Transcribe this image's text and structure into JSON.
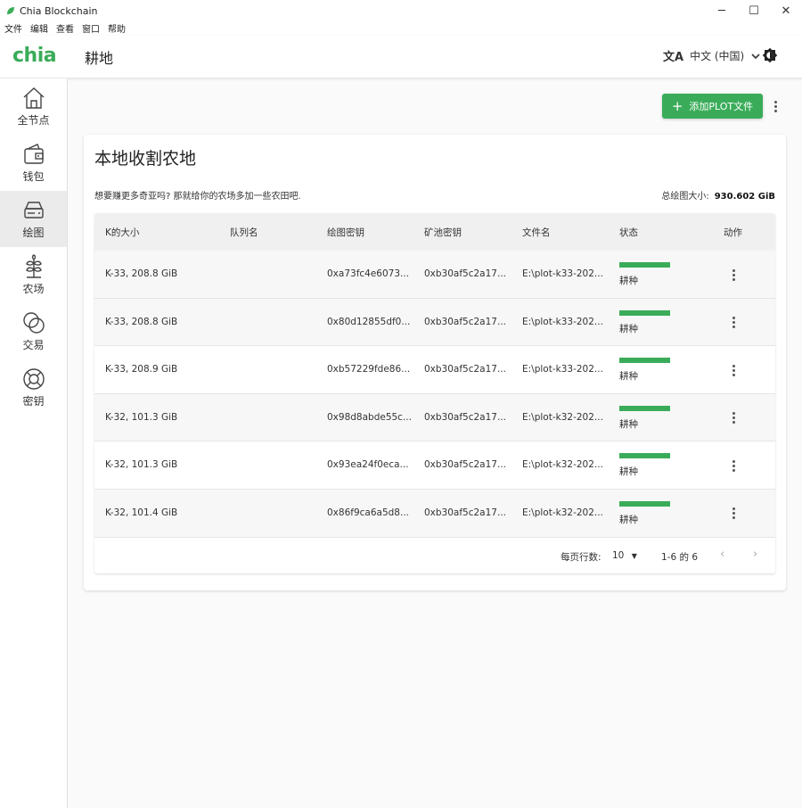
{
  "window": {
    "title": "Chia Blockchain",
    "minimize": "─",
    "maximize": "☐",
    "close": "✕"
  },
  "menu": [
    "文件",
    "编辑",
    "查看",
    "窗口",
    "帮助"
  ],
  "header": {
    "logo": "chia",
    "title": "耕地",
    "language": "中文 (中国)"
  },
  "sidebar": {
    "items": [
      {
        "label": "全节点",
        "icon": "home-icon"
      },
      {
        "label": "钱包",
        "icon": "wallet-icon"
      },
      {
        "label": "绘图",
        "icon": "storage-icon",
        "active": true
      },
      {
        "label": "农场",
        "icon": "sprout-icon"
      },
      {
        "label": "交易",
        "icon": "trade-icon"
      },
      {
        "label": "密钥",
        "icon": "lifebuoy-icon"
      }
    ]
  },
  "toolbar": {
    "add_plot": "添加PLOT文件"
  },
  "card": {
    "title": "本地收割农地",
    "subtitle": "想要赚更多奇亚吗? 那就给你的农场多加一些农田吧.",
    "total_label": "总绘图大小:",
    "total_value": "930.602 GiB"
  },
  "table": {
    "headers": [
      "K的大小",
      "队列名",
      "绘图密钥",
      "矿池密钥",
      "文件名",
      "状态",
      "动作"
    ],
    "rows": [
      {
        "size": "K-33, 208.8 GiB",
        "queue": "",
        "plot_key": "0xa73fc4e6073...",
        "pool_key": "0xb30af5c2a17...",
        "file": "E:\\plot-k33-202...",
        "status": "耕种"
      },
      {
        "size": "K-33, 208.8 GiB",
        "queue": "",
        "plot_key": "0x80d12855df0...",
        "pool_key": "0xb30af5c2a17...",
        "file": "E:\\plot-k33-202...",
        "status": "耕种"
      },
      {
        "size": "K-33, 208.9 GiB",
        "queue": "",
        "plot_key": "0xb57229fde86...",
        "pool_key": "0xb30af5c2a17...",
        "file": "E:\\plot-k33-202...",
        "status": "耕种"
      },
      {
        "size": "K-32, 101.3 GiB",
        "queue": "",
        "plot_key": "0x98d8abde55c...",
        "pool_key": "0xb30af5c2a17...",
        "file": "E:\\plot-k32-202...",
        "status": "耕种"
      },
      {
        "size": "K-32, 101.3 GiB",
        "queue": "",
        "plot_key": "0x93ea24f0eca...",
        "pool_key": "0xb30af5c2a17...",
        "file": "E:\\plot-k32-202...",
        "status": "耕种"
      },
      {
        "size": "K-32, 101.4 GiB",
        "queue": "",
        "plot_key": "0x86f9ca6a5d8...",
        "pool_key": "0xb30af5c2a17...",
        "file": "E:\\plot-k32-202...",
        "status": "耕种"
      }
    ]
  },
  "pagination": {
    "rows_per_page_label": "每页行数:",
    "rows_per_page": "10",
    "range": "1-6 的 6"
  },
  "colors": {
    "accent": "#3aac59"
  }
}
